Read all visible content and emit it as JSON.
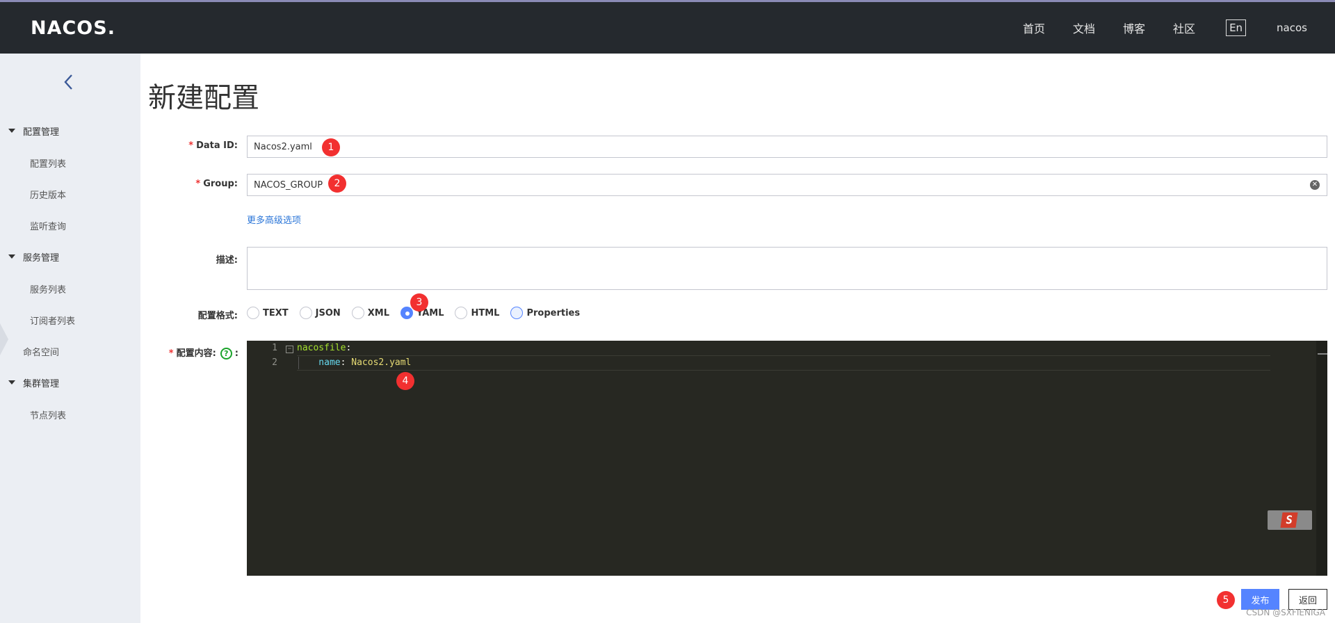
{
  "header": {
    "logo": "NACOS.",
    "nav": [
      "首页",
      "文档",
      "博客",
      "社区"
    ],
    "lang": "En",
    "user": "nacos"
  },
  "sidebar": {
    "groups": [
      {
        "label": "配置管理",
        "items": [
          "配置列表",
          "历史版本",
          "监听查询"
        ]
      },
      {
        "label": "服务管理",
        "items": [
          "服务列表",
          "订阅者列表"
        ]
      },
      {
        "label": "命名空间"
      },
      {
        "label": "集群管理",
        "items": [
          "节点列表"
        ]
      }
    ]
  },
  "page": {
    "title": "新建配置"
  },
  "form": {
    "data_id_label": "Data ID:",
    "data_id_value": "Nacos2.yaml",
    "group_label": "Group:",
    "group_value": "NACOS_GROUP",
    "advanced_link": "更多高级选项",
    "desc_label": "描述:",
    "format_label": "配置格式:",
    "formats": [
      "TEXT",
      "JSON",
      "XML",
      "YAML",
      "HTML",
      "Properties"
    ],
    "selected_format": "YAML",
    "content_label": "配置内容:",
    "content_colon": ":",
    "required_mark": "*",
    "help_glyph": "?"
  },
  "editor": {
    "line_numbers": [
      "1",
      "2"
    ],
    "lines": [
      {
        "key": "nacosfile",
        "sep": ":",
        "value": ""
      },
      {
        "key": "    name",
        "sep": ": ",
        "value": "Nacos2.yaml"
      }
    ],
    "ime_glyph": "S"
  },
  "markers": [
    "1",
    "2",
    "3",
    "4",
    "5"
  ],
  "buttons": {
    "publish": "发布",
    "back": "返回"
  },
  "watermark": "CSDN @SXFIENIGA",
  "colors": {
    "header_bg": "#25292e",
    "sidebar_bg": "#ebeef3",
    "primary": "#5584ff",
    "editor_bg": "#272822",
    "marker": "#f23030"
  }
}
